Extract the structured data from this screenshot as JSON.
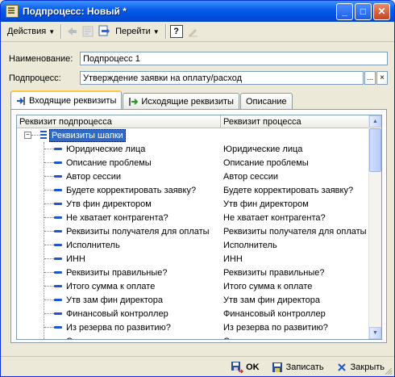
{
  "window": {
    "title": "Подпроцесс: Новый *"
  },
  "toolbar": {
    "actions_label": "Действия",
    "goto_label": "Перейти",
    "help_label": "?"
  },
  "form": {
    "name_label": "Наименование:",
    "name_value": "Подпроцесс 1",
    "subprocess_label": "Подпроцесс:",
    "subprocess_value": "Утверждение заявки на оплату/расход",
    "select_button": "...",
    "clear_button": "×"
  },
  "tabs": [
    {
      "label": "Входящие реквизиты",
      "active": true
    },
    {
      "label": "Исходящие реквизиты",
      "active": false
    },
    {
      "label": "Описание",
      "active": false
    }
  ],
  "grid": {
    "columns": [
      "Реквизит подпроцесса",
      "Реквизит процесса"
    ],
    "group_label": "Реквизиты шапки",
    "rows": [
      {
        "sub": "Юридические лица",
        "proc": "Юридические лица"
      },
      {
        "sub": "Описание проблемы",
        "proc": "Описание проблемы"
      },
      {
        "sub": "Автор сессии",
        "proc": "Автор сессии"
      },
      {
        "sub": "Будете корректировать заявку?",
        "proc": "Будете корректировать заявку?"
      },
      {
        "sub": "Утв фин директором",
        "proc": "Утв фин директором"
      },
      {
        "sub": "Не хватает контрагента?",
        "proc": "Не хватает контрагента?"
      },
      {
        "sub": "Реквизиты получателя для оплаты",
        "proc": "Реквизиты получателя для оплаты"
      },
      {
        "sub": "Исполнитель",
        "proc": "Исполнитель"
      },
      {
        "sub": "ИНН",
        "proc": "ИНН"
      },
      {
        "sub": "Реквизиты правильные?",
        "proc": "Реквизиты правильные?"
      },
      {
        "sub": "Итого сумма к оплате",
        "proc": "Итого сумма к оплате"
      },
      {
        "sub": "Утв зам фин директора",
        "proc": "Утв зам фин директора"
      },
      {
        "sub": "Финансовый контроллер",
        "proc": "Финансовый контроллер"
      },
      {
        "sub": "Из резерва по развитию?",
        "proc": "Из резерва по развитию?"
      },
      {
        "sub": "Состояние заявки",
        "proc": "Состояние заявки"
      }
    ]
  },
  "buttons": {
    "ok": "OK",
    "save": "Записать",
    "close": "Закрыть"
  },
  "colors": {
    "title_bar": "#0055e5",
    "selection": "#316ac5",
    "attr_icon": "#1e56c8"
  }
}
